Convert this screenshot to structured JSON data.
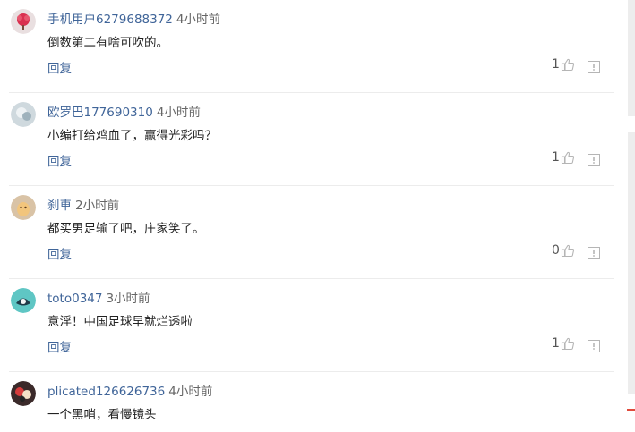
{
  "comments": [
    {
      "user": "手机用户6279688372",
      "time": "4小时前",
      "text": "倒数第二有啥可吹的。",
      "reply": "回复",
      "likes": "1"
    },
    {
      "user": "欧罗巴177690310",
      "time": "4小时前",
      "text": "小编打给鸡血了，赢得光彩吗？",
      "reply": "回复",
      "likes": "1"
    },
    {
      "user": "刹車",
      "time": "2小时前",
      "text": "都买男足输了吧，庄家笑了。",
      "reply": "回复",
      "likes": "0"
    },
    {
      "user": "toto0347",
      "time": "3小时前",
      "text": "意淫！中国足球早就烂透啦",
      "reply": "回复",
      "likes": "1"
    },
    {
      "user": "plicated126626736",
      "time": "4小时前",
      "text": "一个黑哨，看慢镜头",
      "reply": "",
      "likes": ""
    }
  ],
  "colors": {
    "username": "#406599",
    "reply": "#406599",
    "time": "#666666",
    "icon": "#b5b5b5"
  }
}
